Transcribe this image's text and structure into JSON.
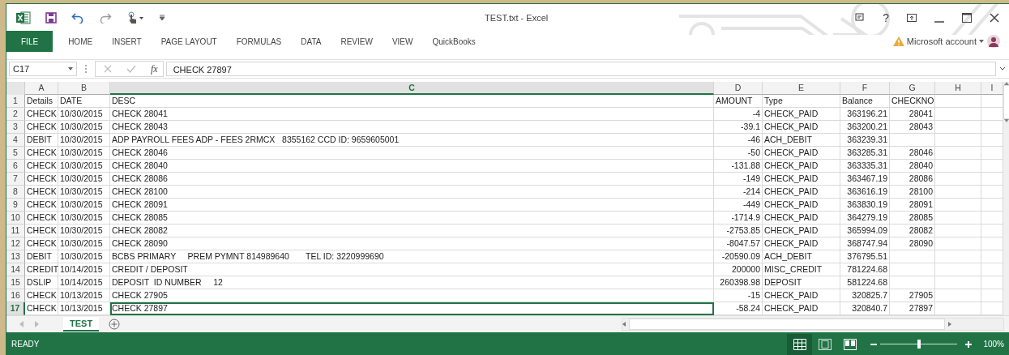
{
  "window": {
    "title": "TEST.txt - Excel",
    "help": "?"
  },
  "ribbon": {
    "tabs": [
      {
        "label": "FILE",
        "selected": true
      },
      {
        "label": "HOME",
        "selected": false
      },
      {
        "label": "INSERT",
        "selected": false
      },
      {
        "label": "PAGE LAYOUT",
        "selected": false
      },
      {
        "label": "FORMULAS",
        "selected": false
      },
      {
        "label": "DATA",
        "selected": false
      },
      {
        "label": "REVIEW",
        "selected": false
      },
      {
        "label": "VIEW",
        "selected": false
      },
      {
        "label": "QuickBooks",
        "selected": false
      }
    ],
    "account": "Microsoft account"
  },
  "formula_bar": {
    "name_box": "C17",
    "fx": "fx",
    "value": "CHECK 27897"
  },
  "sheet": {
    "columns": [
      {
        "label": "A",
        "numeric": false,
        "selected": false
      },
      {
        "label": "B",
        "numeric": false,
        "selected": false
      },
      {
        "label": "C",
        "numeric": false,
        "selected": true
      },
      {
        "label": "D",
        "numeric": true,
        "selected": false
      },
      {
        "label": "E",
        "numeric": false,
        "selected": false
      },
      {
        "label": "F",
        "numeric": true,
        "selected": false
      },
      {
        "label": "G",
        "numeric": true,
        "selected": false
      },
      {
        "label": "H",
        "selected": false
      },
      {
        "label": "I",
        "selected": false
      }
    ],
    "rows": [
      {
        "number": "1",
        "kind": "header",
        "selected": false,
        "cells": {
          "A": "Details",
          "B": "DATE",
          "C": "DESC",
          "D": "AMOUNT",
          "E": "Type",
          "F": "Balance",
          "G": "CHECKNO"
        }
      },
      {
        "number": "2",
        "kind": "data",
        "selected": false,
        "cells": {
          "A": "CHECK",
          "B": "10/30/2015",
          "C": "CHECK 28041",
          "D": "-4",
          "E": "CHECK_PAID",
          "F": "363196.21",
          "G": "28041"
        }
      },
      {
        "number": "3",
        "kind": "data",
        "selected": false,
        "cells": {
          "A": "CHECK",
          "B": "10/30/2015",
          "C": "CHECK 28043",
          "D": "-39.1",
          "E": "CHECK_PAID",
          "F": "363200.21",
          "G": "28043"
        }
      },
      {
        "number": "4",
        "kind": "data",
        "selected": false,
        "cells": {
          "A": "DEBIT",
          "B": "10/30/2015",
          "C": "ADP PAYROLL FEES ADP - FEES 2RMCX   8355162 CCD ID: 9659605001",
          "D": "-46",
          "E": "ACH_DEBIT",
          "F": "363239.31"
        }
      },
      {
        "number": "5",
        "kind": "data",
        "selected": false,
        "cells": {
          "A": "CHECK",
          "B": "10/30/2015",
          "C": "CHECK 28046",
          "D": "-50",
          "E": "CHECK_PAID",
          "F": "363285.31",
          "G": "28046"
        }
      },
      {
        "number": "6",
        "kind": "data",
        "selected": false,
        "cells": {
          "A": "CHECK",
          "B": "10/30/2015",
          "C": "CHECK 28040",
          "D": "-131.88",
          "E": "CHECK_PAID",
          "F": "363335.31",
          "G": "28040"
        }
      },
      {
        "number": "7",
        "kind": "data",
        "selected": false,
        "cells": {
          "A": "CHECK",
          "B": "10/30/2015",
          "C": "CHECK 28086",
          "D": "-149",
          "E": "CHECK_PAID",
          "F": "363467.19",
          "G": "28086"
        }
      },
      {
        "number": "8",
        "kind": "data",
        "selected": false,
        "cells": {
          "A": "CHECK",
          "B": "10/30/2015",
          "C": "CHECK 28100",
          "D": "-214",
          "E": "CHECK_PAID",
          "F": "363616.19",
          "G": "28100"
        }
      },
      {
        "number": "9",
        "kind": "data",
        "selected": false,
        "cells": {
          "A": "CHECK",
          "B": "10/30/2015",
          "C": "CHECK 28091",
          "D": "-449",
          "E": "CHECK_PAID",
          "F": "363830.19",
          "G": "28091"
        }
      },
      {
        "number": "10",
        "kind": "data",
        "selected": false,
        "cells": {
          "A": "CHECK",
          "B": "10/30/2015",
          "C": "CHECK 28085",
          "D": "-1714.9",
          "E": "CHECK_PAID",
          "F": "364279.19",
          "G": "28085"
        }
      },
      {
        "number": "11",
        "kind": "data",
        "selected": false,
        "cells": {
          "A": "CHECK",
          "B": "10/30/2015",
          "C": "CHECK 28082",
          "D": "-2753.85",
          "E": "CHECK_PAID",
          "F": "365994.09",
          "G": "28082"
        }
      },
      {
        "number": "12",
        "kind": "data",
        "selected": false,
        "cells": {
          "A": "CHECK",
          "B": "10/30/2015",
          "C": "CHECK 28090",
          "D": "-8047.57",
          "E": "CHECK_PAID",
          "F": "368747.94",
          "G": "28090"
        }
      },
      {
        "number": "13",
        "kind": "data",
        "selected": false,
        "cells": {
          "A": "DEBIT",
          "B": "10/30/2015",
          "C": "BCBS PRIMARY     PREM PYMNT 814989640       TEL ID: 3220999690",
          "D": "-20590.09",
          "E": "ACH_DEBIT",
          "F": "376795.51"
        }
      },
      {
        "number": "14",
        "kind": "data",
        "selected": false,
        "cells": {
          "A": "CREDIT",
          "B": "10/14/2015",
          "C": "CREDIT / DEPOSIT",
          "D": "200000",
          "E": "MISC_CREDIT",
          "F": "781224.68"
        }
      },
      {
        "number": "15",
        "kind": "data",
        "selected": false,
        "cells": {
          "A": "DSLIP",
          "B": "10/14/2015",
          "C": "DEPOSIT  ID NUMBER     12",
          "D": "260398.98",
          "E": "DEPOSIT",
          "F": "581224.68"
        }
      },
      {
        "number": "16",
        "kind": "data",
        "selected": false,
        "cells": {
          "A": "CHECK",
          "B": "10/13/2015",
          "C": "CHECK 27905",
          "D": "-15",
          "E": "CHECK_PAID",
          "F": "320825.7",
          "G": "27905"
        }
      },
      {
        "number": "17",
        "kind": "data",
        "selected": true,
        "cells": {
          "A": "CHECK",
          "B": "10/13/2015",
          "C": "CHECK 27897",
          "D": "-58.24",
          "E": "CHECK_PAID",
          "F": "320840.7",
          "G": "27897"
        }
      }
    ]
  },
  "sheet_tabs": [
    {
      "label": "TEST",
      "selected": true
    }
  ],
  "status_bar": {
    "status": "READY",
    "views": [
      {
        "kind": "normal",
        "selected": true
      },
      {
        "kind": "page_layout",
        "selected": false
      },
      {
        "kind": "page_break",
        "selected": false
      }
    ],
    "zoom": {
      "level": 0.5,
      "reading": "100%"
    }
  }
}
